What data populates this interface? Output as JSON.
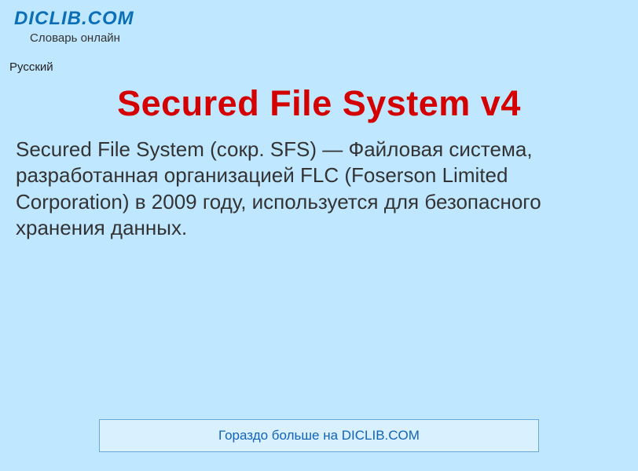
{
  "header": {
    "site_name": "DICLIB.COM",
    "tagline": "Словарь онлайн"
  },
  "language_label": "Русский",
  "article": {
    "title": "Secured File System v4",
    "body": "Secured File System (сокр. SFS) — Файловая система, разработанная организацией FLC (Foserson Limited Corporation) в 2009 году, используется для безопасного хранения данных."
  },
  "footer": {
    "more_link": "Гораздо больше на DICLIB.COM"
  }
}
